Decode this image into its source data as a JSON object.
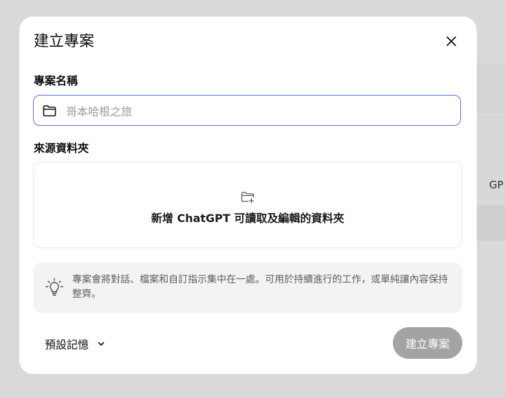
{
  "background": {
    "partial_text": "GP"
  },
  "dialog": {
    "title": "建立專案",
    "close_icon": "close-icon"
  },
  "project_name": {
    "label": "專案名稱",
    "placeholder": "哥本哈根之旅",
    "value": "",
    "icon": "folder-icon"
  },
  "source_folder": {
    "label": "來源資料夾",
    "add_text": "新增 ChatGPT 可讀取及編輯的資料夾",
    "icon": "folder-add-icon"
  },
  "tip": {
    "icon": "lightbulb-icon",
    "text": "專案會將對話、檔案和自訂指示集中在一處。可用於持續進行的工作，或單純讓內容保持整齊。"
  },
  "memory": {
    "label": "預設記憶",
    "icon": "chevron-down-icon"
  },
  "create_button": {
    "label": "建立專案"
  },
  "colors": {
    "input_border": "#5b6fd6",
    "button_disabled": "#a3a3a3",
    "tip_background": "#f3f3f3"
  }
}
